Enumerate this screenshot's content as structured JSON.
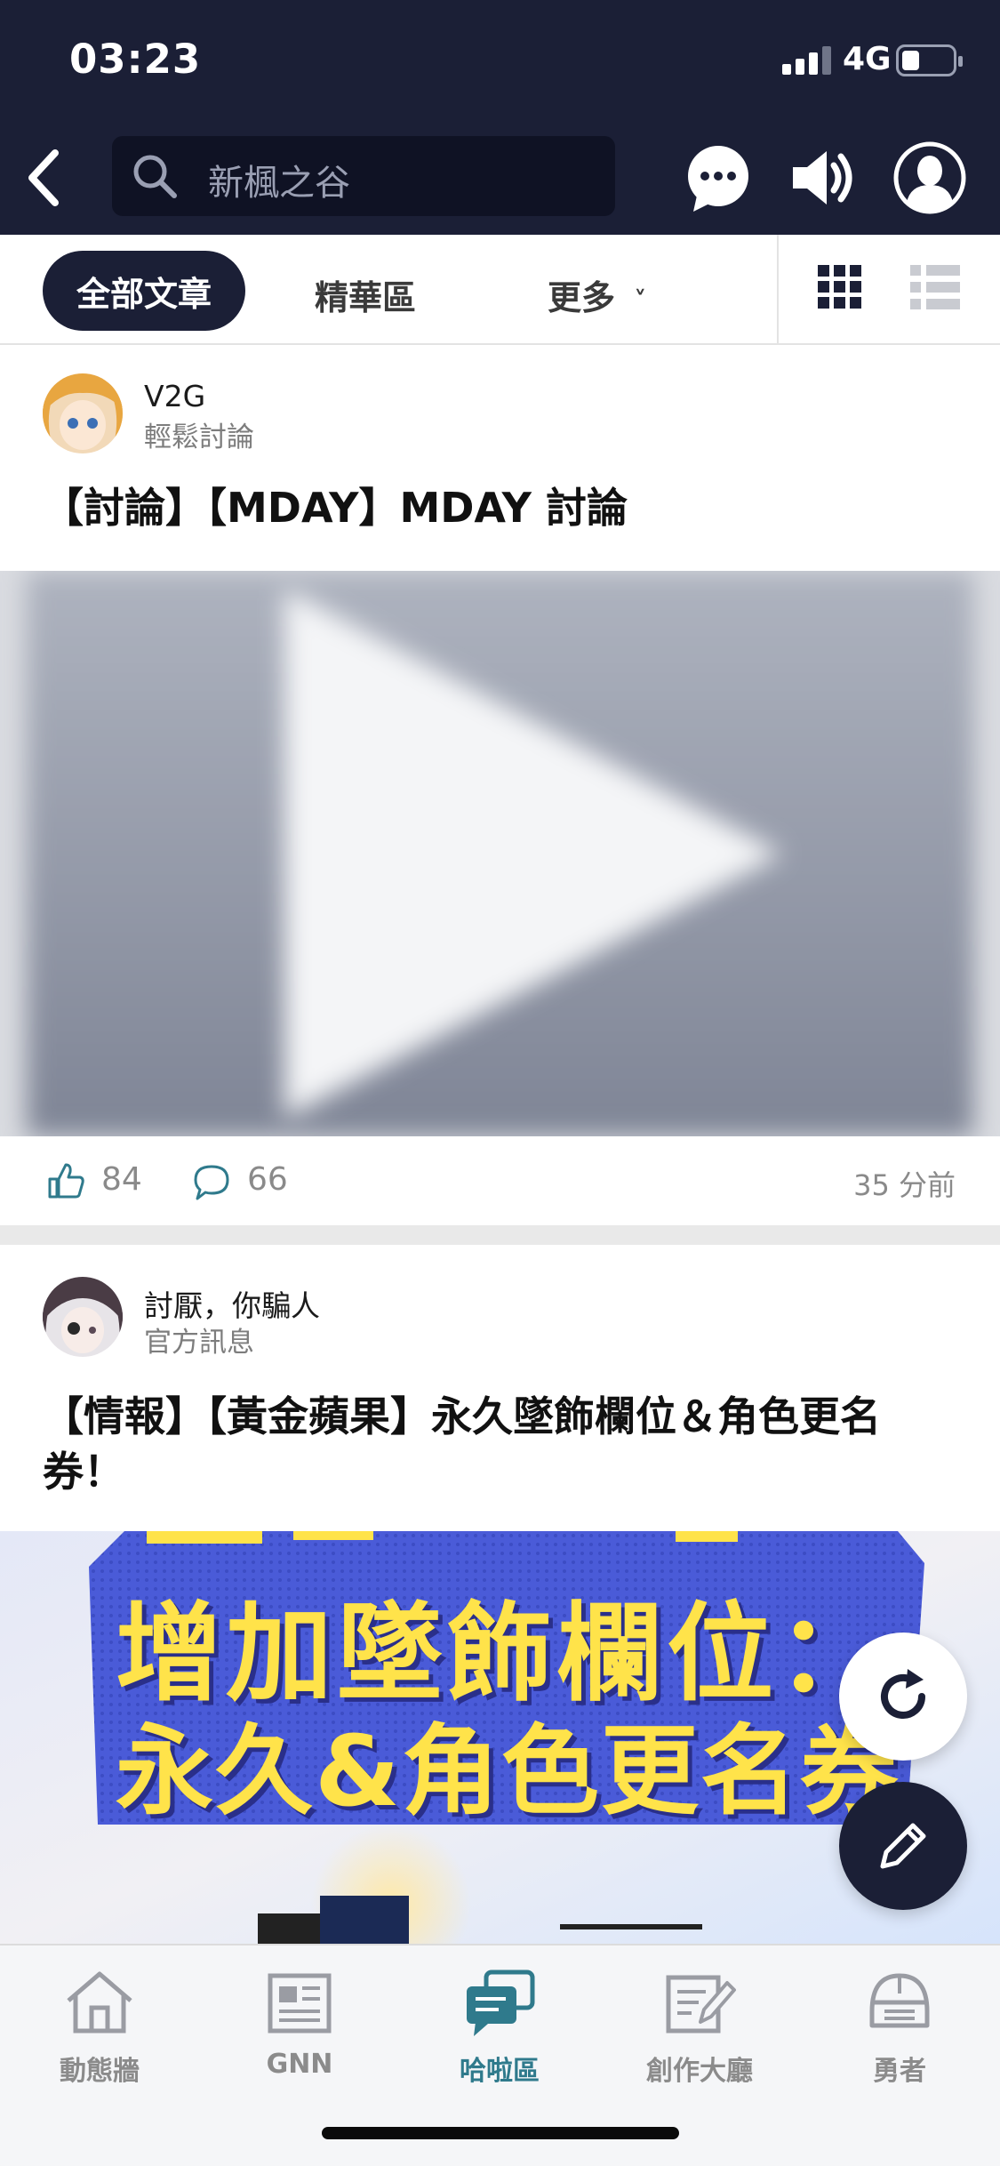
{
  "status_bar": {
    "time": "03:23",
    "network": "4G",
    "battery_level": 0.35
  },
  "header": {
    "search_text": "新楓之谷",
    "icons": [
      "back-icon",
      "search-icon",
      "chat-icon",
      "speaker-icon",
      "profile-icon"
    ]
  },
  "tabs": {
    "active": "全部文章",
    "featured": "精華區",
    "more": "更多",
    "more_arrow": "˅"
  },
  "posts": [
    {
      "author": "V2G",
      "board": "輕鬆討論",
      "title": "【討論】【MDAY】MDAY 討論",
      "likes": "84",
      "comments": "66",
      "time": "35 分前"
    },
    {
      "author": "討厭，你騙人",
      "board": "官方訊息",
      "title": "【情報】【黃金蘋果】永久墜飾欄位＆角色更名券！",
      "banner_line1": "增加墜飾欄位：",
      "banner_line2": "永久&角色更名券"
    }
  ],
  "bottom_nav": [
    {
      "label": "動態牆",
      "icon": "home-icon",
      "active": false
    },
    {
      "label": "GNN",
      "icon": "news-icon",
      "active": false
    },
    {
      "label": "哈啦區",
      "icon": "forum-icon",
      "active": true
    },
    {
      "label": "創作大廳",
      "icon": "creation-icon",
      "active": false
    },
    {
      "label": "勇者",
      "icon": "helmet-icon",
      "active": false
    }
  ],
  "colors": {
    "header_bg": "#1b1f36",
    "active_tab": "#2f7a8c",
    "banner_blue": "#4a5bd8",
    "banner_yellow": "#ffe34a"
  }
}
